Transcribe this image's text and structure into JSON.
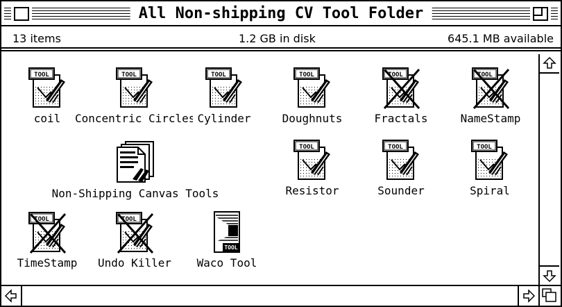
{
  "window": {
    "title": "All Non-shipping CV Tool Folder"
  },
  "info": {
    "item_count": "13 items",
    "disk_used": "1.2 GB in disk",
    "available": "645.1 MB available"
  },
  "icons": {
    "coil": {
      "label": "coil",
      "type": "tool"
    },
    "concentric_circles": {
      "label": "Concentric Circles",
      "type": "tool"
    },
    "cylinder": {
      "label": "Cylinder",
      "type": "tool"
    },
    "doughnuts": {
      "label": "Doughnuts",
      "type": "tool"
    },
    "fractals": {
      "label": "Fractals",
      "type": "tool-disabled"
    },
    "namestamp": {
      "label": "NameStamp",
      "type": "tool-disabled"
    },
    "nonshipping_canvas_tools": {
      "label": "Non-Shipping Canvas Tools",
      "type": "document"
    },
    "resistor": {
      "label": "Resistor",
      "type": "tool"
    },
    "sounder": {
      "label": "Sounder",
      "type": "tool"
    },
    "spiral": {
      "label": "Spiral",
      "type": "tool"
    },
    "timestamp": {
      "label": "TimeStamp",
      "type": "tool-disabled"
    },
    "undo_killer": {
      "label": "Undo Killer",
      "type": "tool-disabled"
    },
    "waco_tool": {
      "label": "Waco Tool",
      "type": "waco-tool"
    }
  },
  "icon_badge_text": "TOOL"
}
